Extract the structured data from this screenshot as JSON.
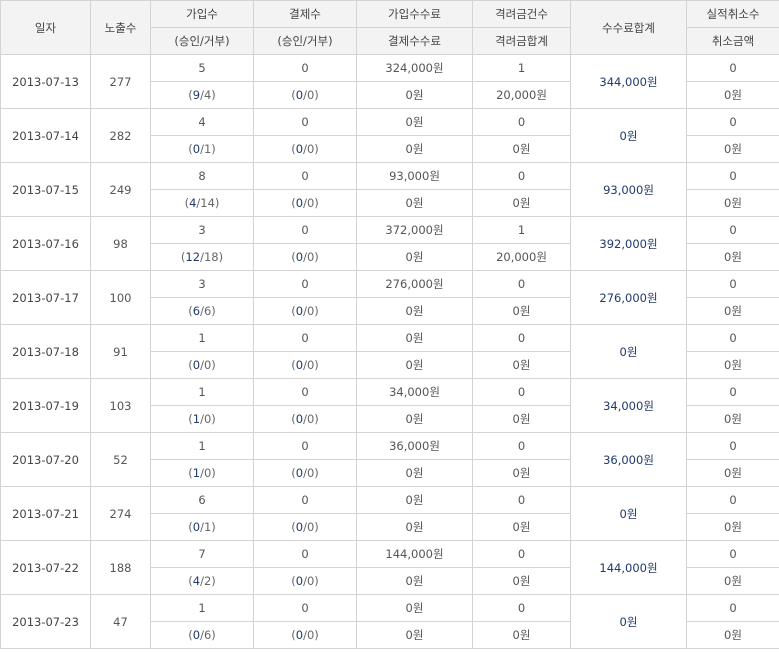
{
  "header": {
    "date": "일자",
    "exposure": "노출수",
    "signup_count": "가입수",
    "signup_sub": "(승인/거부)",
    "payment_count": "결제수",
    "payment_sub": "(승인/거부)",
    "signup_fee": "가입수수료",
    "signup_fee_sub": "결제수수료",
    "bonus_count": "격려금건수",
    "bonus_sum": "격려금합계",
    "fee_total": "수수료합계",
    "cancel_count": "실적취소수",
    "cancel_amount": "취소금액"
  },
  "rows": [
    {
      "date": "2013-07-13",
      "exposure": "277",
      "signup": "5",
      "signup_ok": "9",
      "signup_no": "4",
      "payment": "0",
      "pay_ok": "0",
      "pay_no": "0",
      "signup_fee": "324,000원",
      "pay_fee": "0원",
      "bonus_count": "1",
      "bonus_sum": "20,000원",
      "total": "344,000원",
      "cancel_count": "0",
      "cancel_amount": "0원"
    },
    {
      "date": "2013-07-14",
      "exposure": "282",
      "signup": "4",
      "signup_ok": "0",
      "signup_no": "1",
      "payment": "0",
      "pay_ok": "0",
      "pay_no": "0",
      "signup_fee": "0원",
      "pay_fee": "0원",
      "bonus_count": "0",
      "bonus_sum": "0원",
      "total": "0원",
      "cancel_count": "0",
      "cancel_amount": "0원"
    },
    {
      "date": "2013-07-15",
      "exposure": "249",
      "signup": "8",
      "signup_ok": "4",
      "signup_no": "14",
      "payment": "0",
      "pay_ok": "0",
      "pay_no": "0",
      "signup_fee": "93,000원",
      "pay_fee": "0원",
      "bonus_count": "0",
      "bonus_sum": "0원",
      "total": "93,000원",
      "cancel_count": "0",
      "cancel_amount": "0원"
    },
    {
      "date": "2013-07-16",
      "exposure": "98",
      "signup": "3",
      "signup_ok": "12",
      "signup_no": "18",
      "payment": "0",
      "pay_ok": "0",
      "pay_no": "0",
      "signup_fee": "372,000원",
      "pay_fee": "0원",
      "bonus_count": "1",
      "bonus_sum": "20,000원",
      "total": "392,000원",
      "cancel_count": "0",
      "cancel_amount": "0원"
    },
    {
      "date": "2013-07-17",
      "exposure": "100",
      "signup": "3",
      "signup_ok": "6",
      "signup_no": "6",
      "payment": "0",
      "pay_ok": "0",
      "pay_no": "0",
      "signup_fee": "276,000원",
      "pay_fee": "0원",
      "bonus_count": "0",
      "bonus_sum": "0원",
      "total": "276,000원",
      "cancel_count": "0",
      "cancel_amount": "0원"
    },
    {
      "date": "2013-07-18",
      "exposure": "91",
      "signup": "1",
      "signup_ok": "0",
      "signup_no": "0",
      "payment": "0",
      "pay_ok": "0",
      "pay_no": "0",
      "signup_fee": "0원",
      "pay_fee": "0원",
      "bonus_count": "0",
      "bonus_sum": "0원",
      "total": "0원",
      "cancel_count": "0",
      "cancel_amount": "0원"
    },
    {
      "date": "2013-07-19",
      "exposure": "103",
      "signup": "1",
      "signup_ok": "1",
      "signup_no": "0",
      "payment": "0",
      "pay_ok": "0",
      "pay_no": "0",
      "signup_fee": "34,000원",
      "pay_fee": "0원",
      "bonus_count": "0",
      "bonus_sum": "0원",
      "total": "34,000원",
      "cancel_count": "0",
      "cancel_amount": "0원"
    },
    {
      "date": "2013-07-20",
      "exposure": "52",
      "signup": "1",
      "signup_ok": "1",
      "signup_no": "0",
      "payment": "0",
      "pay_ok": "0",
      "pay_no": "0",
      "signup_fee": "36,000원",
      "pay_fee": "0원",
      "bonus_count": "0",
      "bonus_sum": "0원",
      "total": "36,000원",
      "cancel_count": "0",
      "cancel_amount": "0원"
    },
    {
      "date": "2013-07-21",
      "exposure": "274",
      "signup": "6",
      "signup_ok": "0",
      "signup_no": "1",
      "payment": "0",
      "pay_ok": "0",
      "pay_no": "0",
      "signup_fee": "0원",
      "pay_fee": "0원",
      "bonus_count": "0",
      "bonus_sum": "0원",
      "total": "0원",
      "cancel_count": "0",
      "cancel_amount": "0원"
    },
    {
      "date": "2013-07-22",
      "exposure": "188",
      "signup": "7",
      "signup_ok": "4",
      "signup_no": "2",
      "payment": "0",
      "pay_ok": "0",
      "pay_no": "0",
      "signup_fee": "144,000원",
      "pay_fee": "0원",
      "bonus_count": "0",
      "bonus_sum": "0원",
      "total": "144,000원",
      "cancel_count": "0",
      "cancel_amount": "0원"
    },
    {
      "date": "2013-07-23",
      "exposure": "47",
      "signup": "1",
      "signup_ok": "0",
      "signup_no": "6",
      "payment": "0",
      "pay_ok": "0",
      "pay_no": "0",
      "signup_fee": "0원",
      "pay_fee": "0원",
      "bonus_count": "0",
      "bonus_sum": "0원",
      "total": "0원",
      "cancel_count": "0",
      "cancel_amount": "0원"
    }
  ],
  "colors": {
    "header_bg": "#f3f3f3",
    "border": "#d3d3d3",
    "total_text": "#1f3a6b",
    "text": "#555555"
  }
}
